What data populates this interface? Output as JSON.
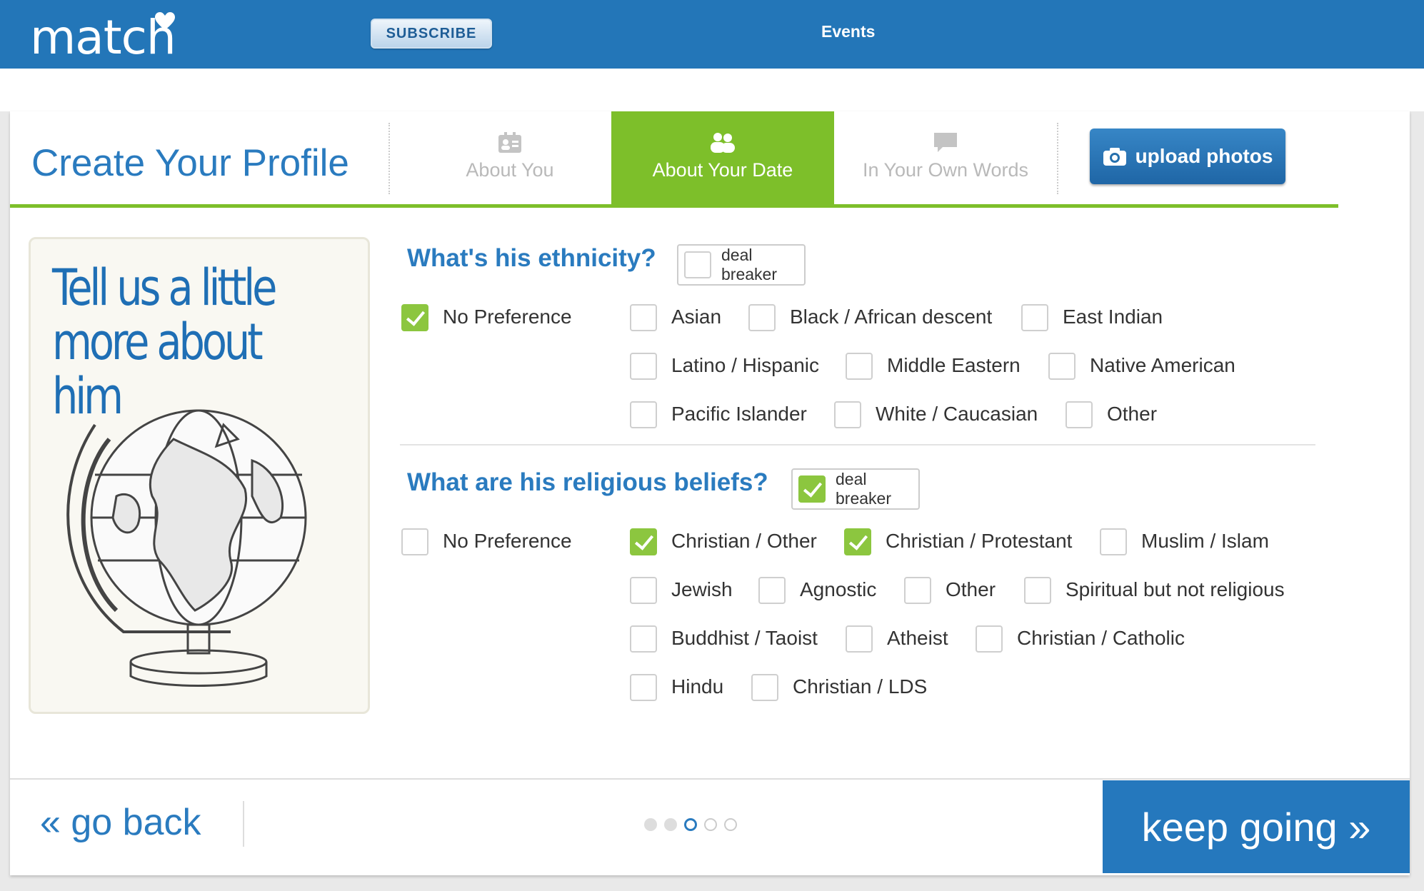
{
  "header": {
    "logo_text": "match",
    "subscribe_label": "SUBSCRIBE",
    "events_label": "Events",
    "colors": {
      "bar": "#2376b8"
    }
  },
  "profile": {
    "title": "Create Your Profile",
    "tabs": [
      {
        "label": "About You",
        "icon": "id-card-icon",
        "active": false
      },
      {
        "label": "About Your Date",
        "icon": "people-icon",
        "active": true
      },
      {
        "label": "In Your Own Words",
        "icon": "speech-bubble-icon",
        "active": false
      }
    ],
    "upload_label": "upload photos",
    "accent_green": "#7dbf2a"
  },
  "promo": {
    "line1": "Tell us a little",
    "line2": "more about him"
  },
  "ethnicity": {
    "question": "What's his ethnicity?",
    "deal_breaker": {
      "label": "deal breaker",
      "checked": false
    },
    "options": [
      {
        "label": "No Preference",
        "checked": true
      },
      {
        "label": "Asian",
        "checked": false
      },
      {
        "label": "Black / African descent",
        "checked": false
      },
      {
        "label": "East Indian",
        "checked": false
      },
      {
        "label": "Latino / Hispanic",
        "checked": false
      },
      {
        "label": "Middle Eastern",
        "checked": false
      },
      {
        "label": "Native American",
        "checked": false
      },
      {
        "label": "Pacific Islander",
        "checked": false
      },
      {
        "label": "White / Caucasian",
        "checked": false
      },
      {
        "label": "Other",
        "checked": false
      }
    ]
  },
  "religion": {
    "question": "What are his religious beliefs?",
    "deal_breaker": {
      "label": "deal breaker",
      "checked": true
    },
    "options": [
      {
        "label": "No Preference",
        "checked": false
      },
      {
        "label": "Christian / Other",
        "checked": true
      },
      {
        "label": "Christian / Protestant",
        "checked": true
      },
      {
        "label": "Muslim / Islam",
        "checked": false
      },
      {
        "label": "Jewish",
        "checked": false
      },
      {
        "label": "Agnostic",
        "checked": false
      },
      {
        "label": "Other",
        "checked": false
      },
      {
        "label": "Spiritual but not religious",
        "checked": false
      },
      {
        "label": "Buddhist / Taoist",
        "checked": false
      },
      {
        "label": "Atheist",
        "checked": false
      },
      {
        "label": "Christian / Catholic",
        "checked": false
      },
      {
        "label": "Hindu",
        "checked": false
      },
      {
        "label": "Christian / LDS",
        "checked": false
      }
    ]
  },
  "footer": {
    "back_label": "« go back",
    "next_label": "keep going »",
    "steps_total": 5,
    "current_step": 3
  }
}
